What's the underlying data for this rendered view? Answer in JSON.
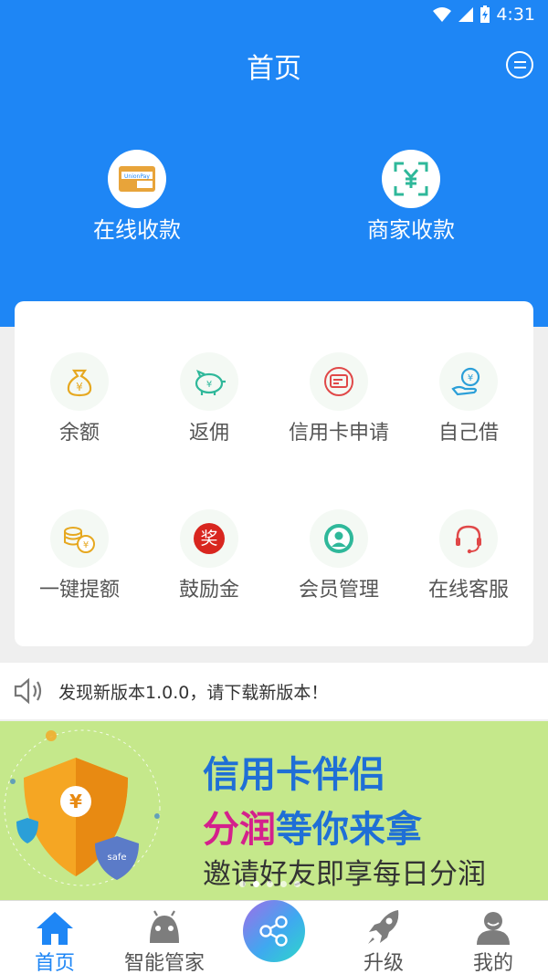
{
  "status_bar": {
    "time": "4:31"
  },
  "header": {
    "title": "首页",
    "pay_items": [
      {
        "label": "在线收款",
        "icon": "unionpay-card-icon"
      },
      {
        "label": "商家收款",
        "icon": "qr-scan-yen-icon"
      }
    ]
  },
  "grid": {
    "items": [
      {
        "label": "余额",
        "icon": "money-bag-icon"
      },
      {
        "label": "返佣",
        "icon": "piggy-bank-icon"
      },
      {
        "label": "信用卡申请",
        "icon": "credit-card-icon"
      },
      {
        "label": "自己借",
        "icon": "hand-coin-icon"
      },
      {
        "label": "一键提额",
        "icon": "coin-stack-icon"
      },
      {
        "label": "鼓励金",
        "icon": "award-icon"
      },
      {
        "label": "会员管理",
        "icon": "member-icon"
      },
      {
        "label": "在线客服",
        "icon": "headset-icon"
      }
    ],
    "award_glyph": "奖"
  },
  "notice": {
    "text": "发现新版本1.0.0，请下载新版本！"
  },
  "banner": {
    "line1": "信用卡伴侣",
    "line2_highlight": "分润",
    "line2_rest": "等你来拿",
    "line3": "邀请好友即享每日分润",
    "shield_symbol": "¥",
    "badge_text": "safe",
    "colors": {
      "background": "#c5e88b",
      "blue": "#1f6fd6",
      "magenta": "#d4208c",
      "shield": "#f5a623"
    }
  },
  "bottom_nav": {
    "items": [
      {
        "label": "首页",
        "icon": "home-icon",
        "active": true
      },
      {
        "label": "智能管家",
        "icon": "android-icon",
        "active": false
      },
      {
        "label": "",
        "icon": "share-icon",
        "active": false
      },
      {
        "label": "升级",
        "icon": "rocket-icon",
        "active": false
      },
      {
        "label": "我的",
        "icon": "user-icon",
        "active": false
      }
    ]
  },
  "colors": {
    "primary": "#1e86f5",
    "icon_gold": "#e6a820",
    "icon_green": "#2fb89a",
    "icon_red": "#e04848",
    "icon_blue": "#2b9fd8"
  }
}
